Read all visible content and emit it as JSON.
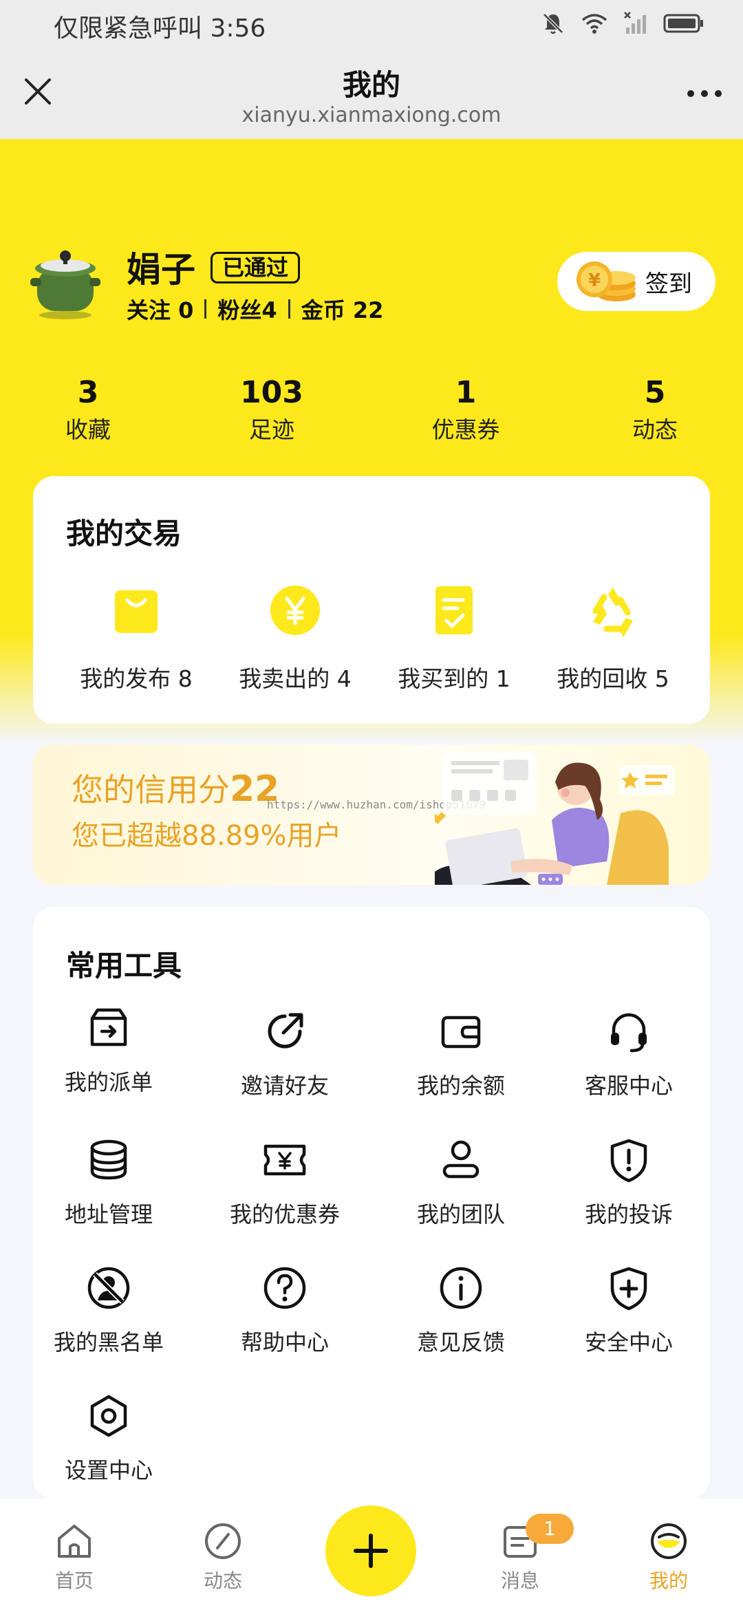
{
  "status_bar": {
    "text": "仅限紧急呼叫 3:56"
  },
  "nav": {
    "title": "我的",
    "url": "xianyu.xianmaxiong.com"
  },
  "profile": {
    "name": "娟子",
    "badge": "已通过",
    "follow": "关注 0",
    "fans": "粉丝4",
    "coins": "金币 22",
    "checkin": "签到"
  },
  "stats": [
    {
      "value": "3",
      "label": "收藏"
    },
    {
      "value": "103",
      "label": "足迹"
    },
    {
      "value": "1",
      "label": "优惠券"
    },
    {
      "value": "5",
      "label": "动态"
    }
  ],
  "trade": {
    "title": "我的交易",
    "items": [
      {
        "label": "我的发布 8",
        "icon": "shopping-bag-icon"
      },
      {
        "label": "我卖出的 4",
        "icon": "yen-coin-icon"
      },
      {
        "label": "我买到的 1",
        "icon": "checklist-icon"
      },
      {
        "label": "我的回收 5",
        "icon": "recycle-icon"
      }
    ]
  },
  "credit": {
    "line1_prefix": "您的信用分",
    "score": "22",
    "line2": "您已超越88.89%用户",
    "watermark": "https://www.huzhan.com/ishop51679"
  },
  "tools": {
    "title": "常用工具",
    "items": [
      {
        "label": "我的派单",
        "icon": "dispatch-box-icon"
      },
      {
        "label": "邀请好友",
        "icon": "share-arrow-icon"
      },
      {
        "label": "我的余额",
        "icon": "wallet-icon"
      },
      {
        "label": "客服中心",
        "icon": "headset-icon"
      },
      {
        "label": "地址管理",
        "icon": "database-stack-icon"
      },
      {
        "label": "我的优惠券",
        "icon": "coupon-ticket-icon"
      },
      {
        "label": "我的团队",
        "icon": "user-team-icon"
      },
      {
        "label": "我的投诉",
        "icon": "shield-alert-icon"
      },
      {
        "label": "我的黑名单",
        "icon": "blocked-user-icon"
      },
      {
        "label": "帮助中心",
        "icon": "question-icon"
      },
      {
        "label": "意见反馈",
        "icon": "info-icon"
      },
      {
        "label": "安全中心",
        "icon": "shield-plus-icon"
      },
      {
        "label": "设置中心",
        "icon": "settings-hex-icon"
      }
    ]
  },
  "tabs": [
    {
      "label": "首页",
      "icon": "home-icon"
    },
    {
      "label": "动态",
      "icon": "compass-icon"
    },
    {
      "label": "消息",
      "icon": "message-icon",
      "badge": "1"
    },
    {
      "label": "我的",
      "icon": "profile-icon",
      "active": true
    }
  ],
  "colors": {
    "brand_yellow": "#fde81c",
    "accent_orange": "#e9a326",
    "badge_orange": "#f7a93a"
  }
}
